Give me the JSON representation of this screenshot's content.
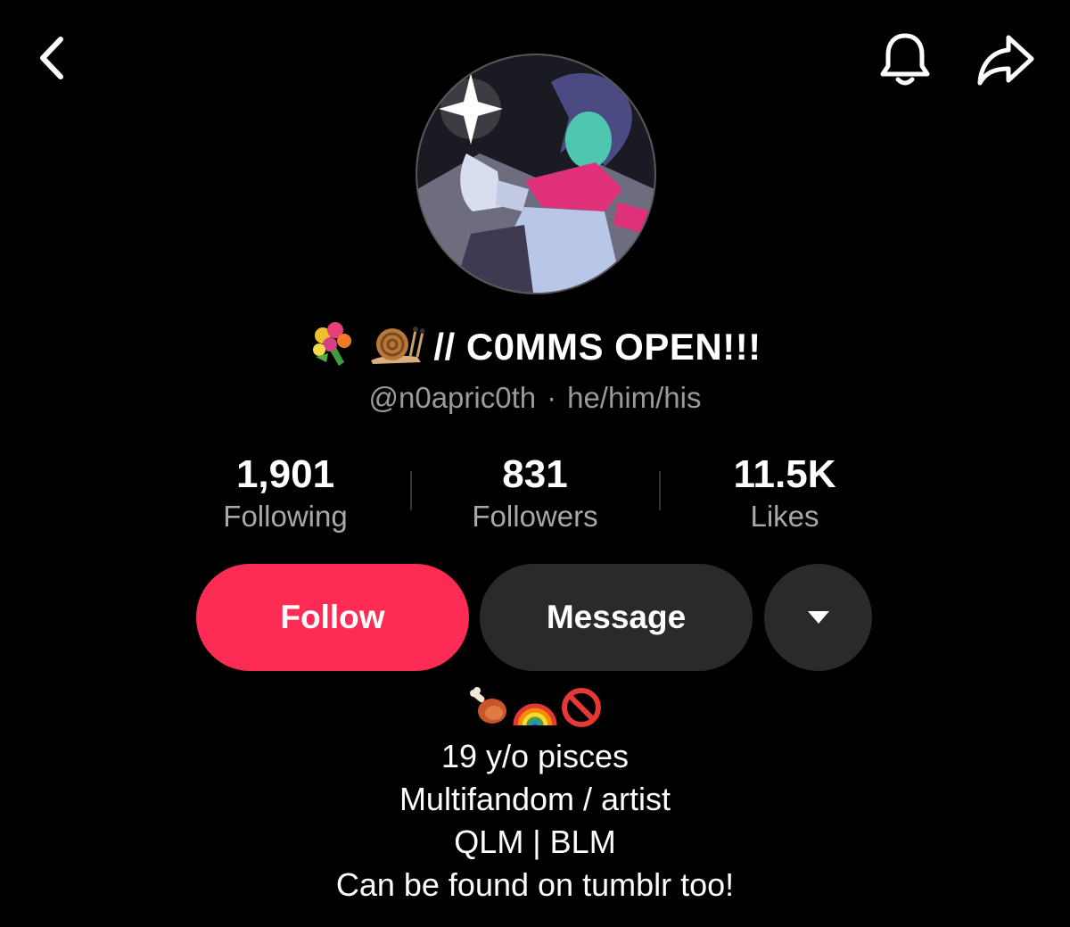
{
  "profile": {
    "display_name": "// C0MMS OPEN!!!",
    "handle": "@n0apric0th",
    "separator": "·",
    "pronouns": "he/him/his"
  },
  "stats": [
    {
      "value": "1,901",
      "label": "Following"
    },
    {
      "value": "831",
      "label": "Followers"
    },
    {
      "value": "11.5K",
      "label": "Likes"
    }
  ],
  "actions": {
    "follow_label": "Follow",
    "message_label": "Message"
  },
  "bio": {
    "lines": [
      "19 y/o pisces",
      "Multifandom / artist",
      "QLM | BLM",
      "Can be found on tumblr too!"
    ]
  },
  "icons": {
    "back": "chevron-left-icon",
    "bell": "bell-icon",
    "share": "share-icon",
    "more": "caret-down-icon",
    "name_emoji": [
      "bouquet-emoji",
      "snail-emoji"
    ],
    "bio_emoji": [
      "meat-on-bone-emoji",
      "rainbow-emoji",
      "prohibited-emoji"
    ]
  },
  "colors": {
    "background": "#000000",
    "follow": "#fe2c55",
    "secondary_button": "#2a2a2a",
    "muted_text": "#9a9a9a"
  }
}
